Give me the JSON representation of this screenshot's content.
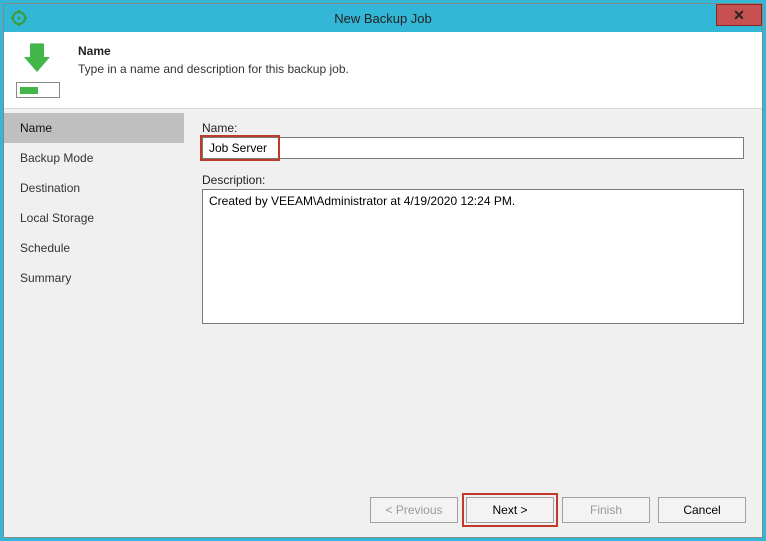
{
  "window": {
    "title": "New Backup Job"
  },
  "header": {
    "heading": "Name",
    "sub": "Type in a name and description for this backup job."
  },
  "sidebar": {
    "items": [
      {
        "label": "Name",
        "active": true
      },
      {
        "label": "Backup Mode",
        "active": false
      },
      {
        "label": "Destination",
        "active": false
      },
      {
        "label": "Local Storage",
        "active": false
      },
      {
        "label": "Schedule",
        "active": false
      },
      {
        "label": "Summary",
        "active": false
      }
    ]
  },
  "form": {
    "name_label": "Name:",
    "name_value": "Job Server",
    "desc_label": "Description:",
    "desc_value": "Created by VEEAM\\Administrator at 4/19/2020 12:24 PM."
  },
  "footer": {
    "previous": "< Previous",
    "next": "Next >",
    "finish": "Finish",
    "cancel": "Cancel"
  }
}
